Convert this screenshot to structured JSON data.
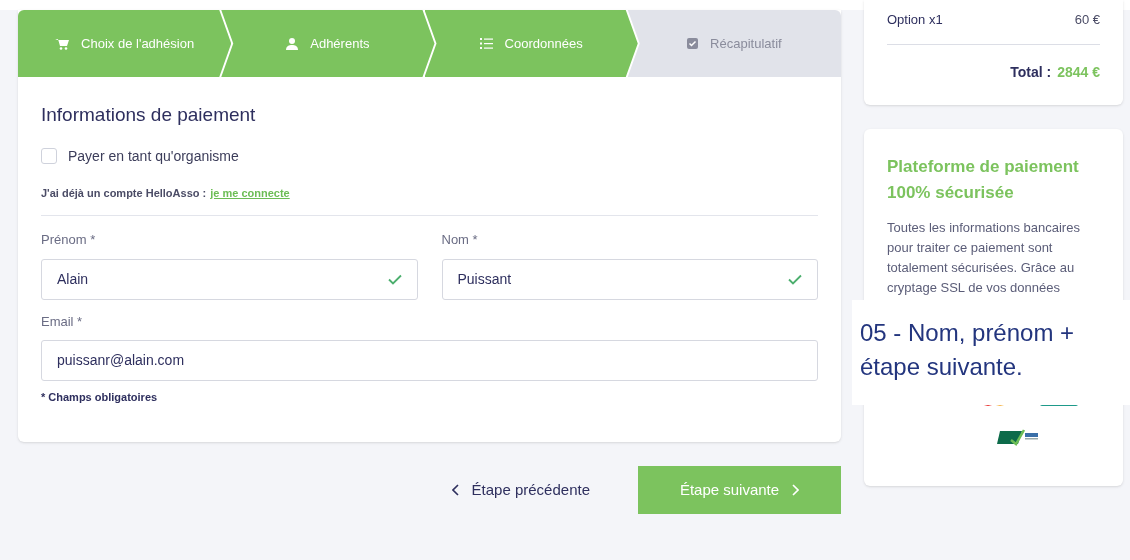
{
  "stepper": [
    {
      "label": "Choix de l'adhésion",
      "done": true
    },
    {
      "label": "Adhérents",
      "done": true
    },
    {
      "label": "Coordonnées",
      "done": true
    },
    {
      "label": "Récapitulatif",
      "done": false
    }
  ],
  "form": {
    "title": "Informations de paiement",
    "organism_checkbox": {
      "label": "Payer en tant qu'organisme",
      "checked": false
    },
    "account_text": "J'ai déjà un compte HelloAsso :",
    "account_link": "je me connecte",
    "fields": [
      {
        "label": "Prénom *",
        "value": "Alain",
        "valid": true
      },
      {
        "label": "Nom *",
        "value": "Puissant",
        "valid": true
      },
      {
        "label": "Email *",
        "value": "puissanr@alain.com",
        "valid": false
      }
    ],
    "required_note": "* Champs obligatoires"
  },
  "nav": {
    "previous": "Étape précédente",
    "next": "Étape suivante"
  },
  "summary": {
    "line_label": "Option x1",
    "line_price": "60 €",
    "total_label": "Total :",
    "total_value": "2844 €"
  },
  "security": {
    "title": "Plateforme de paiement 100% sécurisée",
    "lines": [
      "Toutes les informations bancaires",
      "pour traiter ce paiement sont",
      "totalement sécurisées. Grâce au",
      "cryptage SSL de vos données"
    ]
  },
  "caption": "05 - Nom, prénom + étape suivante."
}
